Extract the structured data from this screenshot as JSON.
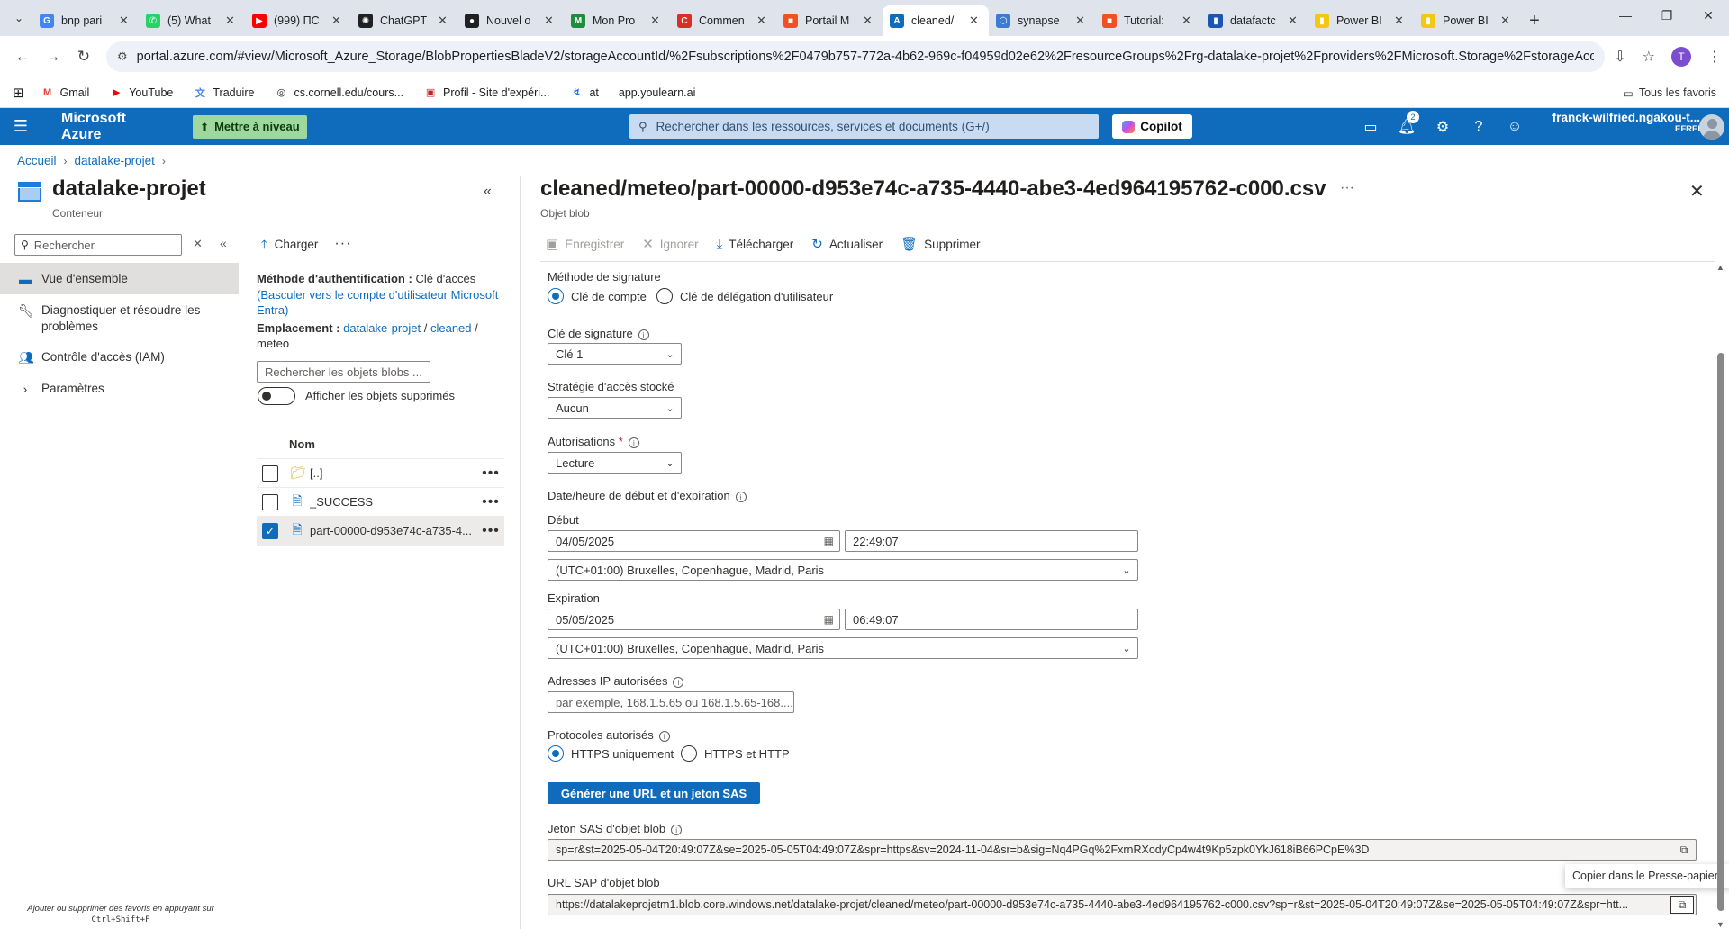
{
  "browser": {
    "tabs": [
      {
        "label": "bnp pari",
        "icon": "google-icon",
        "color": "#4285f4",
        "glyph": "G"
      },
      {
        "label": "(5) What",
        "icon": "whatsapp-icon",
        "color": "#25d366",
        "glyph": "✆"
      },
      {
        "label": "(999) ПС",
        "icon": "youtube-icon",
        "color": "#ff0000",
        "glyph": "▶"
      },
      {
        "label": "ChatGPT",
        "icon": "chatgpt-icon",
        "color": "#202124",
        "glyph": "✺"
      },
      {
        "label": "Nouvel o",
        "icon": "github-icon",
        "color": "#202124",
        "glyph": "●"
      },
      {
        "label": "Mon Pro",
        "icon": "sheet-icon",
        "color": "#1e8e3e",
        "glyph": "M"
      },
      {
        "label": "Commen",
        "icon": "red-c-icon",
        "color": "#d93025",
        "glyph": "C"
      },
      {
        "label": "Portail M",
        "icon": "microsoft-icon",
        "color": "#f25022",
        "glyph": "■"
      },
      {
        "label": "cleaned/",
        "icon": "azure-icon",
        "color": "#0f6cbd",
        "glyph": "A",
        "active": true
      },
      {
        "label": "synapse",
        "icon": "synapse-icon",
        "color": "#3b7bd4",
        "glyph": "⬡"
      },
      {
        "label": "Tutorial:",
        "icon": "microsoft-icon",
        "color": "#f25022",
        "glyph": "■"
      },
      {
        "label": "datafactc",
        "icon": "bar-chart-icon",
        "color": "#1a56b3",
        "glyph": "▮"
      },
      {
        "label": "Power BI",
        "icon": "powerbi-icon",
        "color": "#f2c811",
        "glyph": "▮"
      },
      {
        "label": "Power BI",
        "icon": "powerbi-icon",
        "color": "#f2c811",
        "glyph": "▮"
      }
    ],
    "new_tab": "+",
    "url": "portal.azure.com/#view/Microsoft_Azure_Storage/BlobPropertiesBladeV2/storageAccountId/%2Fsubscriptions%2F0479b757-772a-4b62-969c-f04959d02e62%2FresourceGroups%2Frg-datalake-projet%2Fproviders%2FMicrosoft.Storage%2FstorageAccounts%...",
    "profile_initial": "T",
    "bookmarks": [
      {
        "label": "Gmail",
        "icon": "gmail-icon",
        "glyph": "M",
        "color": "#ea4335"
      },
      {
        "label": "YouTube",
        "icon": "youtube-icon",
        "glyph": "▶",
        "color": "#ff0000"
      },
      {
        "label": "Traduire",
        "icon": "translate-icon",
        "glyph": "文",
        "color": "#4285f4"
      },
      {
        "label": "cs.cornell.edu/cours...",
        "icon": "globe-icon",
        "glyph": "◎",
        "color": "#202124"
      },
      {
        "label": "Profil - Site d'expéri...",
        "icon": "profile-site-icon",
        "glyph": "▣",
        "color": "#c5221f"
      },
      {
        "label": "at",
        "icon": "at-icon",
        "glyph": "↯",
        "color": "#1a73e8"
      },
      {
        "label": "app.youlearn.ai",
        "icon": "",
        "glyph": "",
        "color": "#202124"
      }
    ],
    "all_bookmarks": "Tous les favoris"
  },
  "azure": {
    "brand": "Microsoft Azure",
    "upgrade": "Mettre à niveau",
    "search_placeholder": "Rechercher dans les ressources, services et documents (G+/)",
    "copilot": "Copilot",
    "notifications_count": "2",
    "account_name": "franck-wilfried.ngakou-t...",
    "account_org": "EFREI"
  },
  "breadcrumb": [
    "Accueil",
    "datalake-projet"
  ],
  "resource": {
    "name": "datalake-projet",
    "type": "Conteneur"
  },
  "left_nav": {
    "search_placeholder": "Rechercher",
    "items": [
      {
        "label": "Vue d'ensemble",
        "active": true
      },
      {
        "label": "Diagnostiquer et résoudre les problèmes"
      },
      {
        "label": "Contrôle d'accès (IAM)"
      },
      {
        "label": "Paramètres"
      }
    ],
    "favorites_hint_line1": "Ajouter ou supprimer des favoris en appuyant sur",
    "favorites_hint_line2": "Ctrl+Shift+F"
  },
  "blob_panel": {
    "upload": "Charger",
    "auth_label": "Méthode d'authentification :",
    "auth_value": "Clé d'accès",
    "auth_switch": "(Basculer vers le compte d'utilisateur Microsoft Entra)",
    "location_label": "Emplacement :",
    "location_path": [
      "datalake-projet",
      "cleaned"
    ],
    "location_current": "meteo",
    "search_placeholder": "Rechercher les objets blobs ...",
    "show_deleted": "Afficher les objets supprimés",
    "column_name": "Nom",
    "rows": [
      {
        "name": "[..]",
        "type": "folder",
        "checked": false
      },
      {
        "name": "_SUCCESS",
        "type": "file",
        "checked": false
      },
      {
        "name": "part-00000-d953e74c-a735-4...",
        "type": "file",
        "checked": true
      }
    ]
  },
  "blade": {
    "title": "cleaned/meteo/part-00000-d953e74c-a735-4440-abe3-4ed964195762-c000.csv",
    "subtitle": "Objet blob",
    "toolbar": {
      "save": "Enregistrer",
      "discard": "Ignorer",
      "download": "Télécharger",
      "refresh": "Actualiser",
      "delete": "Supprimer"
    },
    "signing_method_label": "Méthode de signature",
    "signing_options": [
      "Clé de compte",
      "Clé de délégation d'utilisateur"
    ],
    "signing_key_label": "Clé de signature",
    "signing_key_value": "Clé 1",
    "policy_label": "Stratégie d'accès stocké",
    "policy_value": "Aucun",
    "permissions_label": "Autorisations",
    "permissions_required": "*",
    "permissions_value": "Lecture",
    "datetime_label": "Date/heure de début et d'expiration",
    "start_label": "Début",
    "start_date": "04/05/2025",
    "start_time": "22:49:07",
    "start_tz": "(UTC+01:00) Bruxelles, Copenhague, Madrid, Paris",
    "expiry_label": "Expiration",
    "expiry_date": "05/05/2025",
    "expiry_time": "06:49:07",
    "expiry_tz": "(UTC+01:00) Bruxelles, Copenhague, Madrid, Paris",
    "ip_label": "Adresses IP autorisées",
    "ip_placeholder": "par exemple, 168.1.5.65 ou 168.1.5.65-168....",
    "protocols_label": "Protocoles autorisés",
    "protocol_options": [
      "HTTPS uniquement",
      "HTTPS et HTTP"
    ],
    "generate_button": "Générer une URL et un jeton SAS",
    "sas_token_label": "Jeton SAS d'objet blob",
    "sas_token_value": "sp=r&st=2025-05-04T20:49:07Z&se=2025-05-05T04:49:07Z&spr=https&sv=2024-11-04&sr=b&sig=Nq4PGq%2FxrnRXodyCp4w4t9Kp5zpk0YkJ618iB66PCpE%3D",
    "sas_url_label": "URL SAP d'objet blob",
    "sas_url_value": "https://datalakeprojetm1.blob.core.windows.net/datalake-projet/cleaned/meteo/part-00000-d953e74c-a735-4440-abe3-4ed964195762-c000.csv?sp=r&st=2025-05-04T20:49:07Z&se=2025-05-05T04:49:07Z&spr=htt...",
    "copy_tooltip": "Copier dans le Presse-papiers"
  }
}
